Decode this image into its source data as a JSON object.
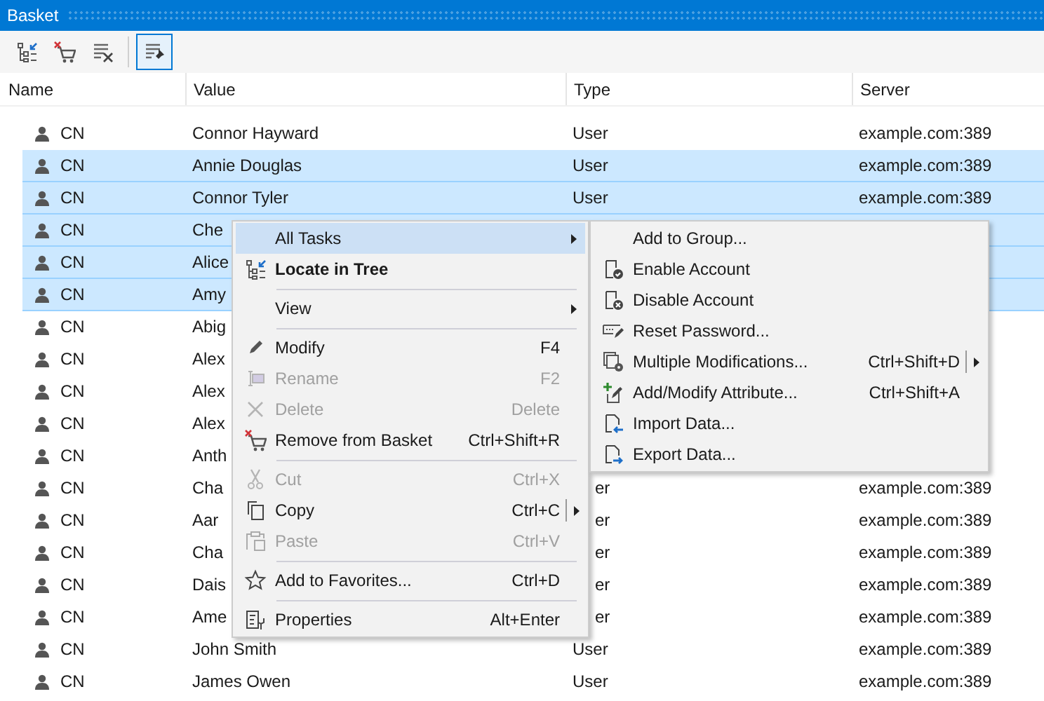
{
  "window": {
    "title": "Basket"
  },
  "toolbar": [
    {
      "selected": false
    },
    {
      "selected": false
    },
    {
      "selected": false
    },
    {
      "selected": true
    }
  ],
  "table": {
    "columns": [
      "Name",
      "Value",
      "Type",
      "Server"
    ],
    "rows": [
      {
        "name": "CN",
        "value": "Connor Hayward",
        "type": "User",
        "server": "example.com:389",
        "selected": false
      },
      {
        "name": "CN",
        "value": "Annie Douglas",
        "type": "User",
        "server": "example.com:389",
        "selected": true
      },
      {
        "name": "CN",
        "value": "Connor Tyler",
        "type": "User",
        "server": "example.com:389",
        "selected": true
      },
      {
        "name": "CN",
        "value": "Che",
        "selected": true
      },
      {
        "name": "CN",
        "value": "Alice",
        "selected": true
      },
      {
        "name": "CN",
        "value": "Amy",
        "selected": true
      },
      {
        "name": "CN",
        "value": "Abig",
        "selected": false
      },
      {
        "name": "CN",
        "value": "Alex",
        "selected": false
      },
      {
        "name": "CN",
        "value": "Alex",
        "selected": false
      },
      {
        "name": "CN",
        "value": "Alex",
        "selected": false
      },
      {
        "name": "CN",
        "value": "Anth",
        "selected": false
      },
      {
        "name": "CN",
        "value": "Cha",
        "type": "er",
        "type_partial": true,
        "server": "example.com:389",
        "selected": false
      },
      {
        "name": "CN",
        "value": "Aar",
        "type": "er",
        "type_partial": true,
        "server": "example.com:389",
        "selected": false
      },
      {
        "name": "CN",
        "value": "Cha",
        "type": "er",
        "type_partial": true,
        "server": "example.com:389",
        "selected": false
      },
      {
        "name": "CN",
        "value": "Dais",
        "type": "er",
        "type_partial": true,
        "server": "example.com:389",
        "selected": false
      },
      {
        "name": "CN",
        "value": "Ame",
        "type": "er",
        "type_partial": true,
        "server": "example.com:389",
        "selected": false
      },
      {
        "name": "CN",
        "value": "John Smith",
        "type": "User",
        "server": "example.com:389",
        "selected": false
      },
      {
        "name": "CN",
        "value": "James Owen",
        "type": "User",
        "server": "example.com:389",
        "selected": false
      }
    ]
  },
  "context_menu": {
    "items": [
      {
        "kind": "item",
        "label": "All Tasks",
        "submenu": true,
        "selected": true
      },
      {
        "kind": "item",
        "label": "Locate in Tree",
        "bold": true,
        "selected": false
      },
      {
        "kind": "separator"
      },
      {
        "kind": "item",
        "label": "View",
        "submenu": true,
        "selected": false
      },
      {
        "kind": "separator"
      },
      {
        "kind": "item",
        "label": "Modify",
        "shortcut": "F4",
        "selected": false
      },
      {
        "kind": "item",
        "label": "Rename",
        "shortcut": "F2",
        "disabled": true,
        "selected": false
      },
      {
        "kind": "item",
        "label": "Delete",
        "shortcut": "Delete",
        "disabled": true,
        "selected": false
      },
      {
        "kind": "item",
        "label": "Remove from Basket",
        "shortcut": "Ctrl+Shift+R",
        "selected": false
      },
      {
        "kind": "separator"
      },
      {
        "kind": "item",
        "label": "Cut",
        "shortcut": "Ctrl+X",
        "disabled": true,
        "selected": false
      },
      {
        "kind": "item",
        "label": "Copy",
        "shortcut": "Ctrl+C",
        "split": true,
        "selected": false
      },
      {
        "kind": "item",
        "label": "Paste",
        "shortcut": "Ctrl+V",
        "disabled": true,
        "selected": false
      },
      {
        "kind": "separator"
      },
      {
        "kind": "item",
        "label": "Add to Favorites...",
        "shortcut": "Ctrl+D",
        "selected": false
      },
      {
        "kind": "separator"
      },
      {
        "kind": "item",
        "label": "Properties",
        "shortcut": "Alt+Enter",
        "selected": false
      }
    ]
  },
  "submenu": {
    "items": [
      {
        "label": "Add to Group..."
      },
      {
        "label": "Enable Account"
      },
      {
        "label": "Disable Account"
      },
      {
        "label": "Reset Password..."
      },
      {
        "label": "Multiple Modifications...",
        "shortcut": "Ctrl+Shift+D",
        "split": true
      },
      {
        "label": "Add/Modify Attribute...",
        "shortcut": "Ctrl+Shift+A"
      },
      {
        "label": "Import Data..."
      },
      {
        "label": "Export Data..."
      }
    ]
  }
}
